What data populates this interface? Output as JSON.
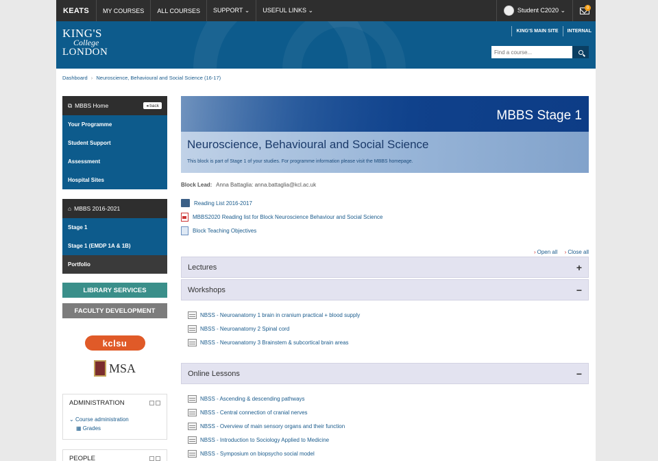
{
  "topnav": {
    "brand": "KEATS",
    "items": [
      {
        "label": "MY COURSES"
      },
      {
        "label": "ALL COURSES"
      },
      {
        "label": "SUPPORT ⌄"
      },
      {
        "label": "USEFUL LINKS ⌄"
      }
    ],
    "user": "Student C2020 ⌄",
    "message_count": "0"
  },
  "header": {
    "logo": {
      "line1": "KING'S",
      "line2": "College",
      "line3": "LONDON"
    },
    "links": [
      "KING'S MAIN SITE",
      "INTERNAL"
    ],
    "search_placeholder": "Find a course..."
  },
  "breadcrumb": {
    "home": "Dashboard",
    "sep": "›",
    "current": "Neuroscience, Behavioural and Social Science (16-17)"
  },
  "sidebar": {
    "home_block": {
      "title": "MBBS Home",
      "back": "back",
      "items": [
        "Your Programme",
        "Student Support",
        "Assessment",
        "Hospital Sites"
      ]
    },
    "programme_block": {
      "title": "MBBS 2016-2021",
      "items": [
        "Stage 1",
        "Stage 1 (EMDP 1A & 1B)"
      ],
      "dark_item": "Portfolio"
    },
    "library_btn": "LIBRARY SERVICES",
    "faculty_btn": "FACULTY DEVELOPMENT",
    "kclsu": "kclsu",
    "msa": "MSA",
    "admin": {
      "title": "ADMINISTRATION",
      "course_admin": "Course administration",
      "grades": "Grades"
    },
    "people": {
      "title": "PEOPLE"
    }
  },
  "main": {
    "banner": {
      "stage": "MBBS Stage 1",
      "title": "Neuroscience, Behavioural and Social Science",
      "subtitle": "This block is part of Stage 1 of your studies. For programme information please visit the MBBS homepage."
    },
    "block_lead_label": "Block Lead:",
    "block_lead_value": "Anna Battaglia: anna.battaglia@kcl.ac.uk",
    "resources": [
      {
        "label": "Reading List 2016-2017",
        "icon": "book-icon"
      },
      {
        "label": "MBBS2020 Reading list for Block Neuroscience Behaviour and Social Science",
        "icon": "pdf-icon"
      },
      {
        "label": "Block Teaching Objectives",
        "icon": "doc-icon"
      }
    ],
    "open_all": "Open all",
    "close_all": "Close all",
    "sections": [
      {
        "title": "Lectures",
        "toggle": "+"
      },
      {
        "title": "Workshops",
        "toggle": "−"
      },
      {
        "title": "Online Lessons",
        "toggle": "−"
      }
    ],
    "workshops": [
      "NBSS - Neuroanatomy 1 brain in cranium practical + blood supply",
      "NBSS - Neuroanatomy 2 Spinal cord",
      "NBSS - Neuroanatomy 3 Brainstem & subcortical brain areas"
    ],
    "online_lessons": [
      "NBSS - Ascending & descending pathways",
      "NBSS - Central connection of cranial nerves",
      "NBSS - Overview of main sensory organs and their function",
      "NBSS - Introduction to Sociology Applied to Medicine",
      "NBSS - Symposium on biopsycho social model"
    ]
  }
}
